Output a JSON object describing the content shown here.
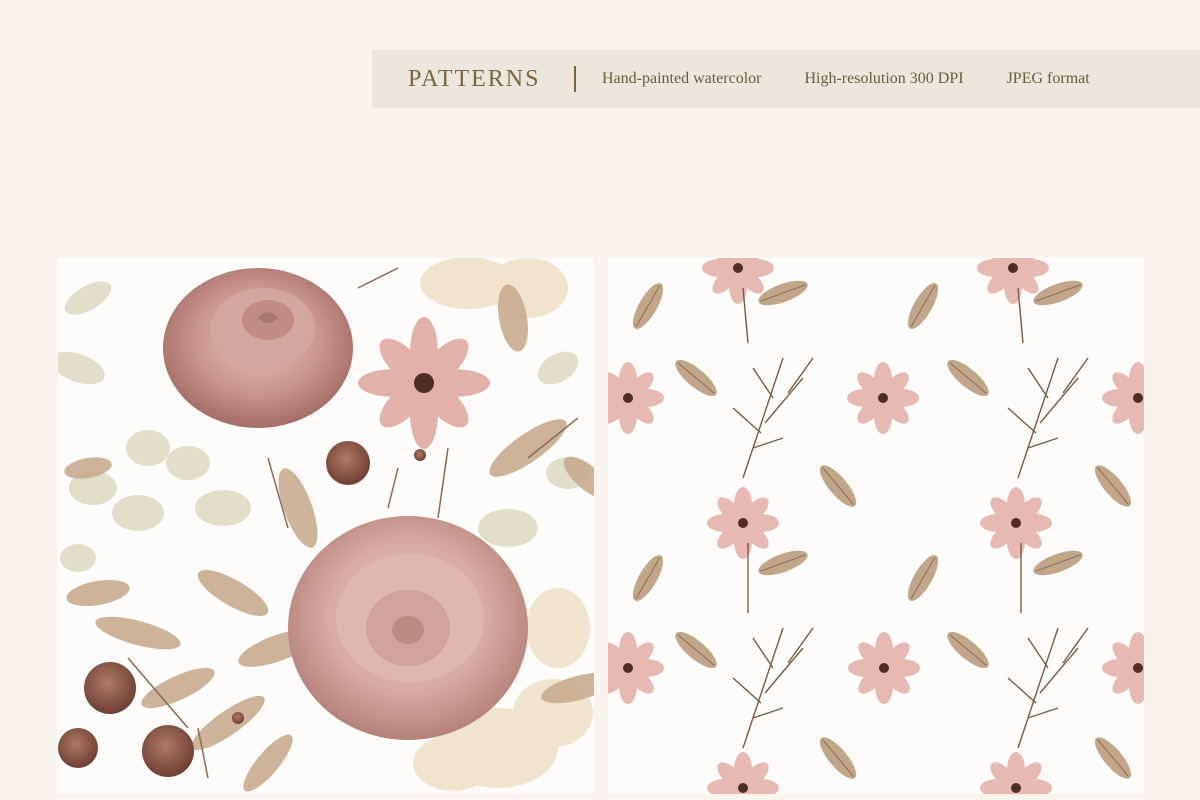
{
  "banner": {
    "title": "PATTERNS",
    "features": [
      "Hand-painted watercolor",
      "High-resolution 300 DPI",
      "JPEG format"
    ]
  },
  "colors": {
    "background": "#f8f5ee",
    "banner": "#ece7dc",
    "title_text": "#7a6640",
    "rose": "#c79a94",
    "rose_dark": "#9e6a63",
    "cosmos": "#e2b2aa",
    "leaf_brown": "#b89a7e",
    "leaf_sage": "#dcdcc4",
    "orchid": "#f1e4cf",
    "scabiosa": "#7d4a3c"
  },
  "patterns": [
    {
      "name": "Dense rose floral pattern",
      "icon": "rose-floral-pattern-icon"
    },
    {
      "name": "Scattered cosmos pattern",
      "icon": "cosmos-scatter-pattern-icon"
    }
  ]
}
